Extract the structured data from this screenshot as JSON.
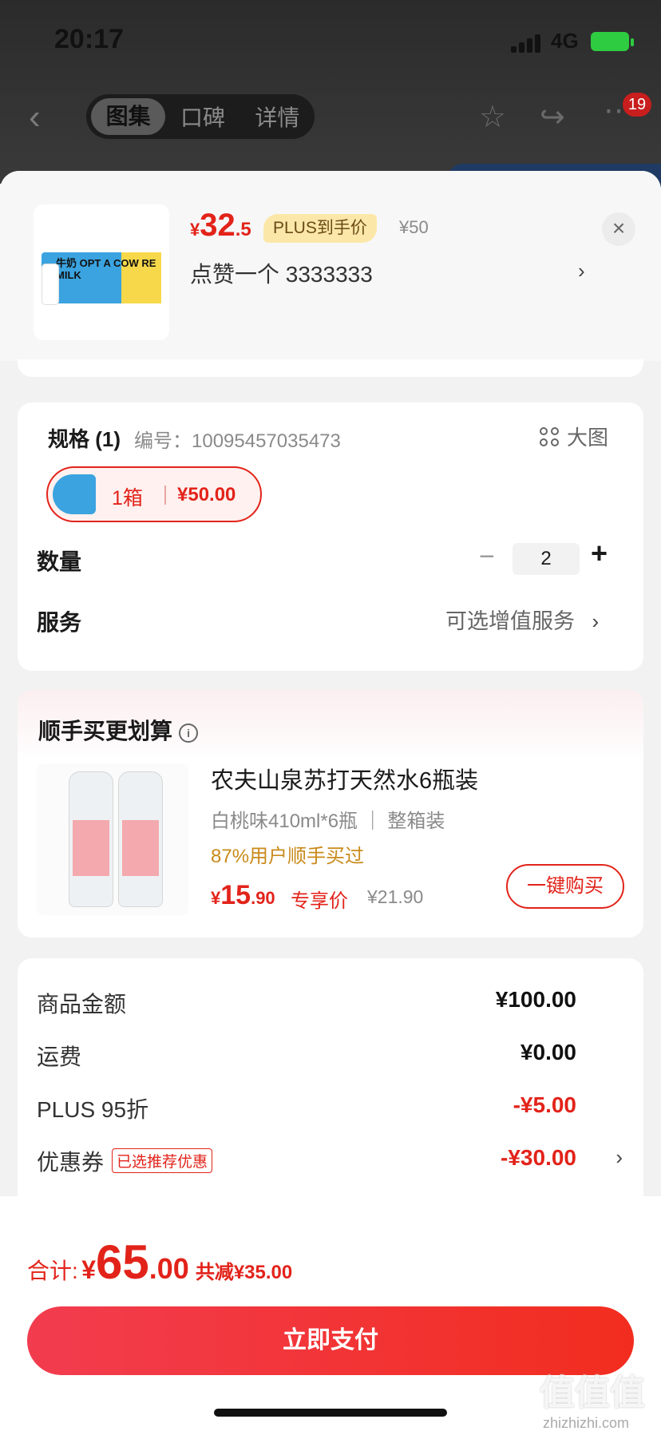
{
  "status_bar": {
    "time": "20:17",
    "network": "4G"
  },
  "nav": {
    "tabs": [
      "图集",
      "口碑",
      "详情"
    ],
    "active_tab": 0,
    "badge_count": "19"
  },
  "product": {
    "price_currency": "¥",
    "price_int": "32",
    "price_dec": ".5",
    "plus_tag": "PLUS到手价",
    "original_price": "¥50",
    "address": "点赞一个  3333333",
    "box_text": "牛奶 OPT A COW RE MILK"
  },
  "spec": {
    "title": "规格 (1)",
    "code": "编号：10095457035473",
    "big_image_label": "大图",
    "sku_label": "1箱",
    "sku_price": "¥50.00",
    "qty_label": "数量",
    "qty_value": "2",
    "service_label": "服务",
    "service_value": "可选增值服务"
  },
  "recommend": {
    "title": "顺手买更划算",
    "name": "农夫山泉苏打天然水6瓶装",
    "spec": "白桃味410ml*6瓶 ｜ 整箱装",
    "percent": "87%用户顺手买过",
    "price_currency": "¥",
    "price_int": "15",
    "price_dec": ".90",
    "price_tag": "专享价",
    "original_price": "¥21.90",
    "buy_label": "一键购买"
  },
  "summary": {
    "rows": [
      {
        "label": "商品金额",
        "value": "¥100.00"
      },
      {
        "label": "运费",
        "value": "¥0.00"
      },
      {
        "label": "PLUS 95折",
        "value": "-¥5.00"
      },
      {
        "label": "优惠券",
        "value": "-¥30.00",
        "tag": "已选推荐优惠"
      }
    ]
  },
  "footer": {
    "total_label": "合计:",
    "currency": "¥",
    "total_int": "65",
    "total_dec": ".00",
    "saved": "共减¥35.00",
    "pay_label": "立即支付"
  },
  "watermark": {
    "main": "值值值",
    "site": "zhizhizhi.com"
  },
  "colors": {
    "accent": "#e2231a",
    "plus_gold": "#fbe7a8"
  }
}
